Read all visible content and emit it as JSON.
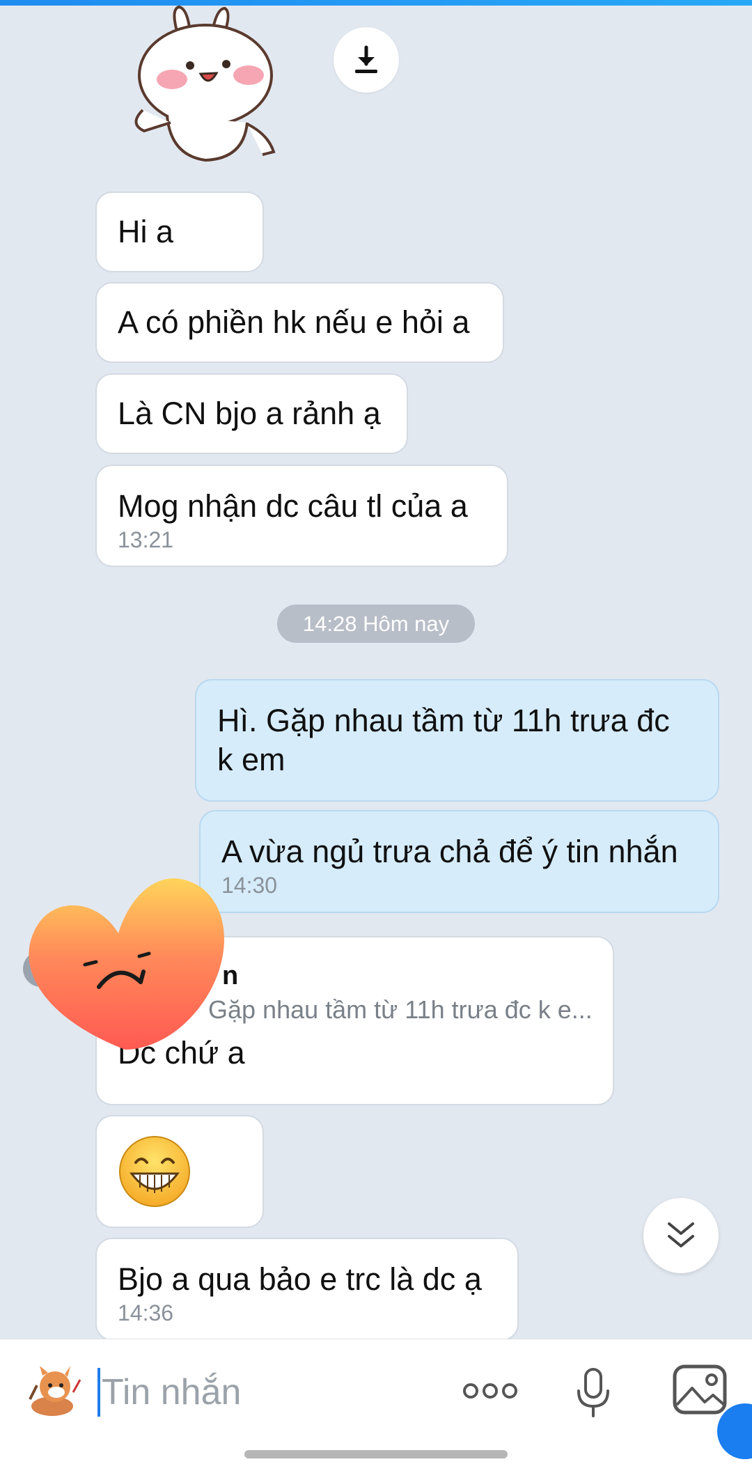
{
  "messages": [
    {
      "text": "Hi a"
    },
    {
      "text": "A có phiền hk nếu e hỏi a"
    },
    {
      "text": "Là CN bjo a rảnh ạ"
    },
    {
      "text": "Mog nhận dc câu tl của a",
      "time": "13:21"
    }
  ],
  "date_divider": "14:28 Hôm nay",
  "outgoing": [
    {
      "line1": "Hì. Gặp nhau tầm từ 11h trưa đc",
      "line2": "k em"
    },
    {
      "text": "A vừa ngủ trưa chả để ý tin nhắn",
      "time": "14:30"
    }
  ],
  "reply": {
    "name": "n",
    "quote": "Gặp nhau tầm từ 11h trưa đc k e...",
    "text": "Dc chứ a"
  },
  "last_message": {
    "text": "Bjo a qua bảo e trc là dc ạ",
    "time": "14:36"
  },
  "input": {
    "placeholder": "Tin nhắn"
  },
  "icons": {
    "download": "download-icon",
    "scroll_down": "chevron-double-down-icon",
    "more": "more-icon",
    "mic": "microphone-icon",
    "gallery": "image-icon",
    "sticker": "sticker-icon",
    "emoji": "grinning-emoji-icon"
  },
  "colors": {
    "background": "#e2e8f0",
    "incoming_bubble": "#ffffff",
    "outgoing_bubble": "#d6ecfb",
    "accent": "#1f7de8"
  }
}
